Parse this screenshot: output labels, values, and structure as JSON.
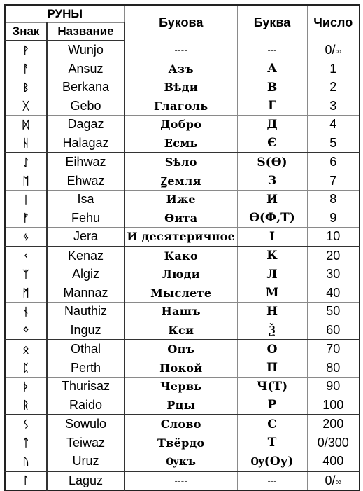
{
  "header": {
    "group_label": "РУНЫ",
    "sign_label": "Знак",
    "name_label": "Название",
    "bukova_label": "Букова",
    "bukva_label": "Буква",
    "number_label": "Число"
  },
  "rows": [
    {
      "sign": "ᚹ",
      "sign_icon": "wunjo-rune-icon",
      "name": "Wunjo",
      "bukova": "----",
      "bukva": "---",
      "number": "0/∞"
    },
    {
      "sign": "ᚨ",
      "sign_icon": "ansuz-rune-icon",
      "name": "Ansuz",
      "bukova": "Азъ",
      "bukva": "А",
      "number": "1"
    },
    {
      "sign": "ᛒ",
      "sign_icon": "berkana-rune-icon",
      "name": "Berkana",
      "bukova": "Вѣди",
      "bukva": "В",
      "number": "2"
    },
    {
      "sign": "ᚷ",
      "sign_icon": "gebo-rune-icon",
      "name": "Gebo",
      "bukova": "Глаголь",
      "bukva": "Г",
      "number": "3"
    },
    {
      "sign": "ᛞ",
      "sign_icon": "dagaz-rune-icon",
      "name": "Dagaz",
      "bukova": "Добро",
      "bukva": "Д",
      "number": "4"
    },
    {
      "sign": "ᚺ",
      "sign_icon": "halagaz-rune-icon",
      "name": "Halagaz",
      "bukova": "Есмь",
      "bukva": "Є",
      "number": "5"
    },
    {
      "sign": "ᛇ",
      "sign_icon": "eihwaz-rune-icon",
      "name": "Eihwaz",
      "bukova": "Ѕѣло",
      "bukva": "Ѕ(Ѳ)",
      "number": "6"
    },
    {
      "sign": "ᛖ",
      "sign_icon": "ehwaz-rune-icon",
      "name": "Ehwaz",
      "bukova": "Ꙁемля",
      "bukva": "З",
      "number": "7"
    },
    {
      "sign": "ᛁ",
      "sign_icon": "isa-rune-icon",
      "name": "Isa",
      "bukova": "Иже",
      "bukva": "И",
      "number": "8"
    },
    {
      "sign": "ᚠ",
      "sign_icon": "fehu-rune-icon",
      "name": "Fehu",
      "bukova": "Ѳита",
      "bukva": "Ѳ(Ф,Т)",
      "number": "9"
    },
    {
      "sign": "ᛃ",
      "sign_icon": "jera-rune-icon",
      "name": "Jera",
      "bukova": "И десятеричное",
      "bukva": "І",
      "number": "10"
    },
    {
      "sign": "ᚲ",
      "sign_icon": "kenaz-rune-icon",
      "name": "Kenaz",
      "bukova": "Како",
      "bukva": "К",
      "number": "20"
    },
    {
      "sign": "ᛉ",
      "sign_icon": "algiz-rune-icon",
      "name": "Algiz",
      "bukova": "Люди",
      "bukva": "Л",
      "number": "30"
    },
    {
      "sign": "ᛗ",
      "sign_icon": "mannaz-rune-icon",
      "name": "Mannaz",
      "bukova": "Мыслете",
      "bukva": "М",
      "number": "40"
    },
    {
      "sign": "ᚾ",
      "sign_icon": "nauthiz-rune-icon",
      "name": "Nauthiz",
      "bukova": "Нашъ",
      "bukva": "Н",
      "number": "50"
    },
    {
      "sign": "ᛜ",
      "sign_icon": "inguz-rune-icon",
      "name": "Inguz",
      "bukova": "Кси",
      "bukva": "Ѯ",
      "number": "60"
    },
    {
      "sign": "ᛟ",
      "sign_icon": "othal-rune-icon",
      "name": "Othal",
      "bukova": "Онъ",
      "bukva": "О",
      "number": "70"
    },
    {
      "sign": "ᛈ",
      "sign_icon": "perth-rune-icon",
      "name": "Perth",
      "bukova": "Покой",
      "bukva": "П",
      "number": "80"
    },
    {
      "sign": "ᚦ",
      "sign_icon": "thurisaz-rune-icon",
      "name": "Thurisaz",
      "bukova": "Червь",
      "bukva": "Ч(Т)",
      "number": "90"
    },
    {
      "sign": "ᚱ",
      "sign_icon": "raido-rune-icon",
      "name": "Raido",
      "bukova": "Рцы",
      "bukva": "Р",
      "number": "100"
    },
    {
      "sign": "ᛊ",
      "sign_icon": "sowulo-rune-icon",
      "name": "Sowulo",
      "bukova": "Слово",
      "bukva": "С",
      "number": "200"
    },
    {
      "sign": "ᛏ",
      "sign_icon": "teiwaz-rune-icon",
      "name": "Teiwaz",
      "bukova": "Твёрдо",
      "bukva": "Т",
      "number": "0/300"
    },
    {
      "sign": "ᚢ",
      "sign_icon": "uruz-rune-icon",
      "name": "Uruz",
      "bukova": "Ѹкъ",
      "bukva": "Ѹ(Оу)",
      "number": "400"
    },
    {
      "sign": "ᛚ",
      "sign_icon": "laguz-rune-icon",
      "name": "Laguz",
      "bukova": "----",
      "bukva": "---",
      "number": "0/∞"
    }
  ]
}
